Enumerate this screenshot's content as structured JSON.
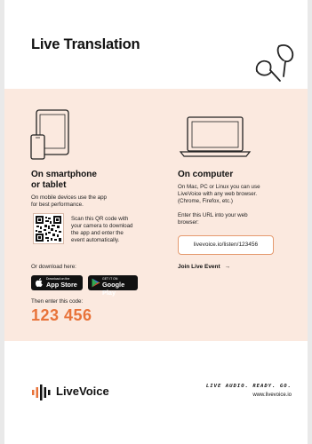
{
  "header": {
    "title": "Live Translation"
  },
  "mobile": {
    "heading_line1": "On smartphone",
    "heading_line2": "or tablet",
    "desc_line1": "On mobile devices use the app",
    "desc_line2": "for best performance.",
    "qr_text": [
      "Scan this QR code with",
      "your camera to download",
      "the app and enter the",
      "event automatically."
    ],
    "download_label": "Or download here:",
    "app_store": {
      "top": "Download on the",
      "main": "App Store"
    },
    "google_play": {
      "top": "GET IT ON",
      "main": "Google Play"
    },
    "code_label": "Then enter this code:",
    "code": "123 456"
  },
  "computer": {
    "heading": "On computer",
    "desc": [
      "On Mac, PC or Linux you can use",
      "LiveVoice with any web browser.",
      "(Chrome, Firefox, etc.)"
    ],
    "url_label": [
      "Enter this URL into your web",
      "browser:"
    ],
    "url": "livevoice.io/listen/123456",
    "join_label": "Join Live Event",
    "join_arrow": "→"
  },
  "footer": {
    "brand": "LiveVoice",
    "tagline": "LIVE AUDIO. READY. GO.",
    "website": "www.livevoice.io"
  },
  "colors": {
    "accent": "#e8733a",
    "band": "#fbe9df"
  }
}
